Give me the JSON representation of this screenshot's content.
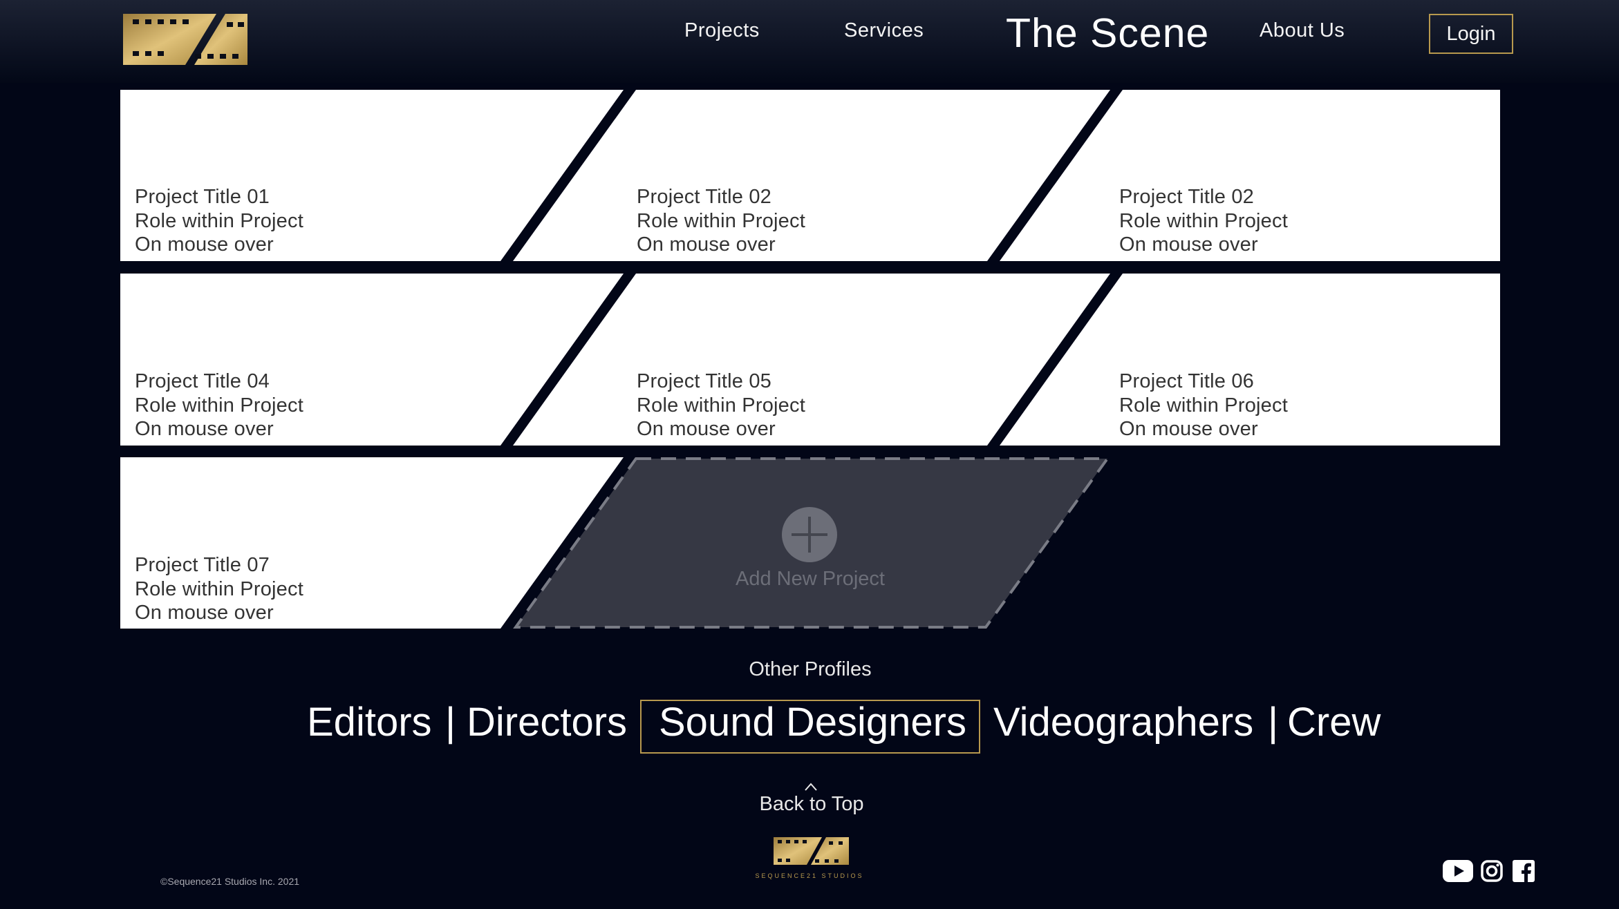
{
  "header": {
    "logo_icon": "film-strip-logo-icon",
    "nav": [
      "Projects",
      "Services"
    ],
    "brand_title": "The Scene",
    "about_label": "About Us",
    "login_label": "Login"
  },
  "projects": [
    {
      "title": "Project Title 01",
      "role": "Role within Project",
      "hover": "On mouse over"
    },
    {
      "title": "Project Title 02",
      "role": "Role within Project",
      "hover": "On mouse over"
    },
    {
      "title": "Project Title 02",
      "role": "Role within Project",
      "hover": "On mouse over"
    },
    {
      "title": "Project Title 04",
      "role": "Role within Project",
      "hover": "On mouse over"
    },
    {
      "title": "Project Title 05",
      "role": "Role within Project",
      "hover": "On mouse over"
    },
    {
      "title": "Project Title 06",
      "role": "Role within Project",
      "hover": "On mouse over"
    },
    {
      "title": "Project Title 07",
      "role": "Role within Project",
      "hover": "On mouse over"
    }
  ],
  "add_project": {
    "label": "Add New Project",
    "icon": "plus-icon"
  },
  "other_profiles": {
    "title": "Other Profiles",
    "items": [
      "Editors",
      "Directors",
      "Sound Designers",
      "Videographers",
      "Crew"
    ],
    "separator": "|",
    "selected": "Sound Designers"
  },
  "footer": {
    "back_to_top": "Back to Top",
    "back_icon": "chevron-up-icon",
    "logo_text": "SEQUENCE21 STUDIOS",
    "copyright": "©Sequence21 Studios Inc. 2021",
    "social_icons": [
      "youtube-icon",
      "instagram-icon",
      "facebook-icon"
    ]
  },
  "colors": {
    "background": "#020617",
    "gold": "#b8994e",
    "card": "#ffffff",
    "add_card": "#363844"
  }
}
